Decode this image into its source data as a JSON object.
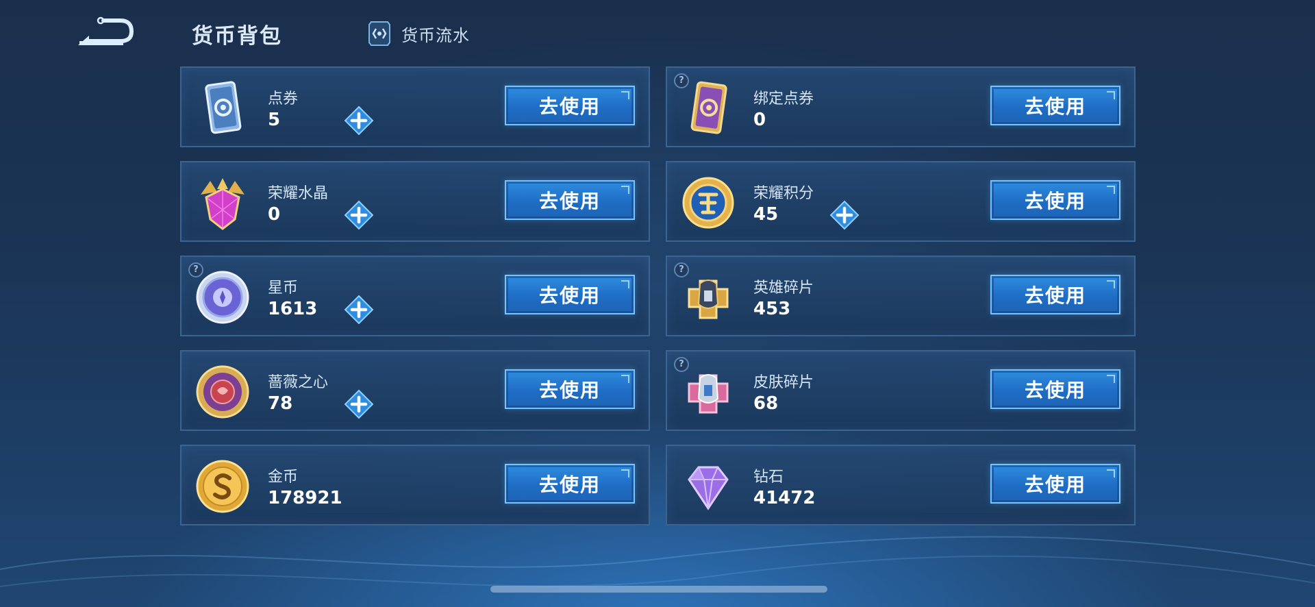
{
  "header": {
    "title": "货币背包",
    "flow_link": "货币流水"
  },
  "use_label": "去使用",
  "items": [
    {
      "name": "点券",
      "value": "5",
      "icon": "ticket-card-icon",
      "has_plus": true,
      "has_help": false
    },
    {
      "name": "绑定点券",
      "value": "0",
      "icon": "bound-ticket-card-icon",
      "has_plus": false,
      "has_help": true
    },
    {
      "name": "荣耀水晶",
      "value": "0",
      "icon": "glory-crystal-icon",
      "has_plus": true,
      "has_help": false
    },
    {
      "name": "荣耀积分",
      "value": "45",
      "icon": "glory-points-icon",
      "has_plus": true,
      "has_help": false
    },
    {
      "name": "星币",
      "value": "1613",
      "icon": "star-coin-icon",
      "has_plus": true,
      "has_help": true
    },
    {
      "name": "英雄碎片",
      "value": "453",
      "icon": "hero-fragment-icon",
      "has_plus": false,
      "has_help": true
    },
    {
      "name": "蔷薇之心",
      "value": "78",
      "icon": "rose-heart-icon",
      "has_plus": true,
      "has_help": false
    },
    {
      "name": "皮肤碎片",
      "value": "68",
      "icon": "skin-fragment-icon",
      "has_plus": false,
      "has_help": true
    },
    {
      "name": "金币",
      "value": "178921",
      "icon": "gold-coin-icon",
      "has_plus": false,
      "has_help": false
    },
    {
      "name": "钻石",
      "value": "41472",
      "icon": "diamond-icon",
      "has_plus": false,
      "has_help": false
    }
  ],
  "help_glyph": "?",
  "colors": {
    "background": "#1b3556",
    "card_border": "#3b6491",
    "button": "#2677d0",
    "button_border": "#78c4ff",
    "plus": "#2f8de0"
  }
}
